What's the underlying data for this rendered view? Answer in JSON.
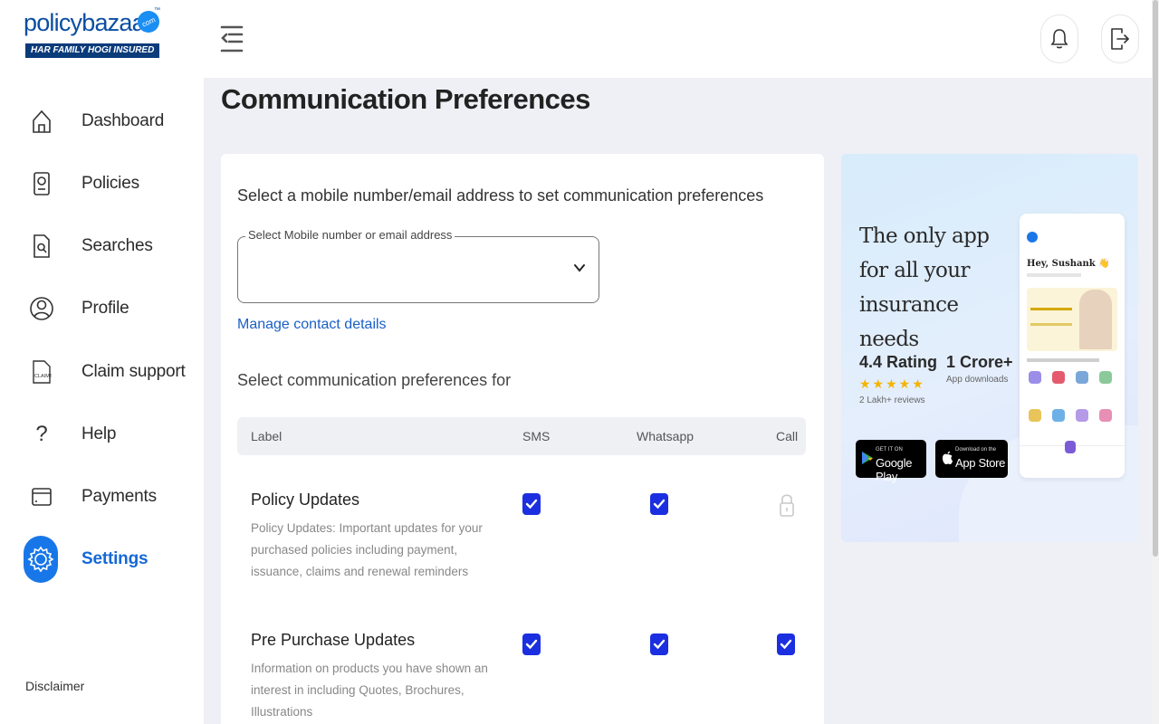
{
  "header": {
    "logo": {
      "word": "policybazaar",
      "dot": "com",
      "tm": "™",
      "tagline": "HAR FAMILY HOGI INSURED"
    }
  },
  "sidebar": {
    "items": [
      {
        "label": "Dashboard",
        "icon": "home-icon"
      },
      {
        "label": "Policies",
        "icon": "policy-document-icon"
      },
      {
        "label": "Searches",
        "icon": "search-document-icon"
      },
      {
        "label": "Profile",
        "icon": "user-icon"
      },
      {
        "label": "Claim support",
        "icon": "claims-document-icon"
      },
      {
        "label": "Help",
        "icon": "question-icon"
      },
      {
        "label": "Payments",
        "icon": "card-icon"
      },
      {
        "label": "Settings",
        "icon": "gear-icon",
        "active": true
      }
    ],
    "disclaimer": "Disclaimer"
  },
  "main": {
    "title": "Communication Preferences",
    "select_heading": "Select a mobile number/email address to set communication preferences",
    "select_field": {
      "legend": "Select Mobile number or email address",
      "value": ""
    },
    "manage_link": "Manage contact details",
    "prefs_for": "Select communication preferences for",
    "table": {
      "headers": {
        "label": "Label",
        "sms": "SMS",
        "whatsapp": "Whatsapp",
        "call": "Call"
      },
      "rows": [
        {
          "title": "Policy Updates",
          "description": "Policy Updates: Important updates for your purchased policies including payment, issuance, claims and renewal reminders",
          "sms": true,
          "whatsapp": true,
          "call": "locked"
        },
        {
          "title": "Pre Purchase Updates",
          "description": "Information on products you have shown an interest in including Quotes, Brochures, Illustrations",
          "sms": true,
          "whatsapp": true,
          "call": true
        }
      ]
    }
  },
  "promo": {
    "headline": "The only app for all your insurance needs",
    "rating": {
      "value": "4.4 Rating",
      "stars": "★★★★★",
      "reviews": "2 Lakh+ reviews"
    },
    "downloads": {
      "value": "1 Crore+",
      "label": "App downloads"
    },
    "google_play": {
      "small": "GET IT ON",
      "big": "Google Play"
    },
    "app_store": {
      "small": "Download on the",
      "big": "App Store"
    },
    "phone": {
      "greeting": "Hey, Sushank 👋"
    }
  },
  "colors": {
    "accent": "#1877e8",
    "checkbox": "#1b2fe0",
    "link": "#1a5fc6",
    "brand": "#0b4ea2"
  }
}
